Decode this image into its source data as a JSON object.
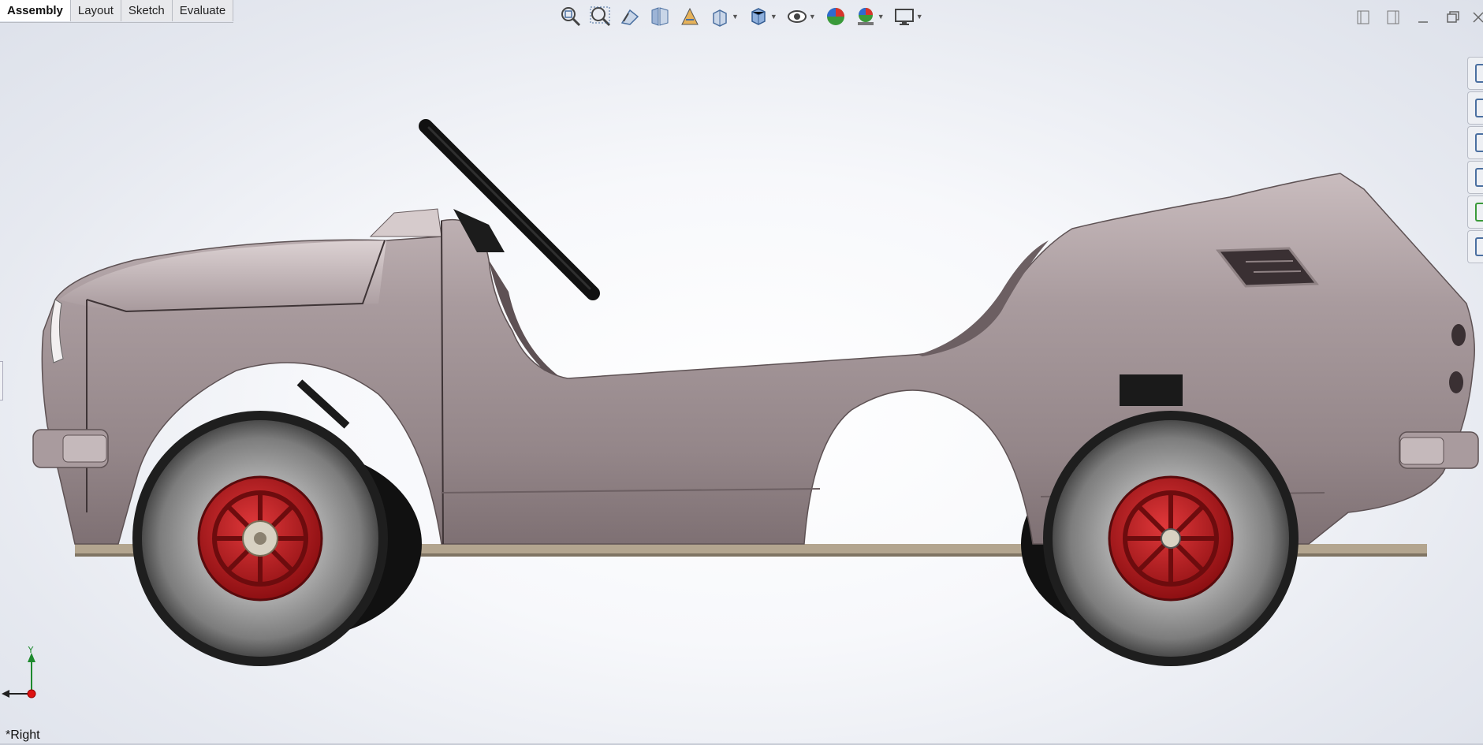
{
  "tabs": [
    {
      "label": "Assembly",
      "active": true
    },
    {
      "label": "Layout",
      "active": false
    },
    {
      "label": "Sketch",
      "active": false
    },
    {
      "label": "Evaluate",
      "active": false
    }
  ],
  "heads_up_toolbar": [
    "zoom-to-fit-icon",
    "zoom-to-area-icon",
    "previous-view-icon",
    "section-view-icon",
    "dynamic-annotation-icon",
    "view-orientation-icon",
    "display-style-icon",
    "hide-show-items-icon",
    "edit-appearance-icon",
    "apply-scene-icon",
    "view-settings-icon"
  ],
  "triad": {
    "y_label": "Y"
  },
  "view_label": "*Right",
  "colors": {
    "body": "#a89a9d",
    "body_dark": "#7d6f72",
    "tire": "#8a8a8a",
    "rim": "#c0181b",
    "accent": "#4a6fa0"
  }
}
